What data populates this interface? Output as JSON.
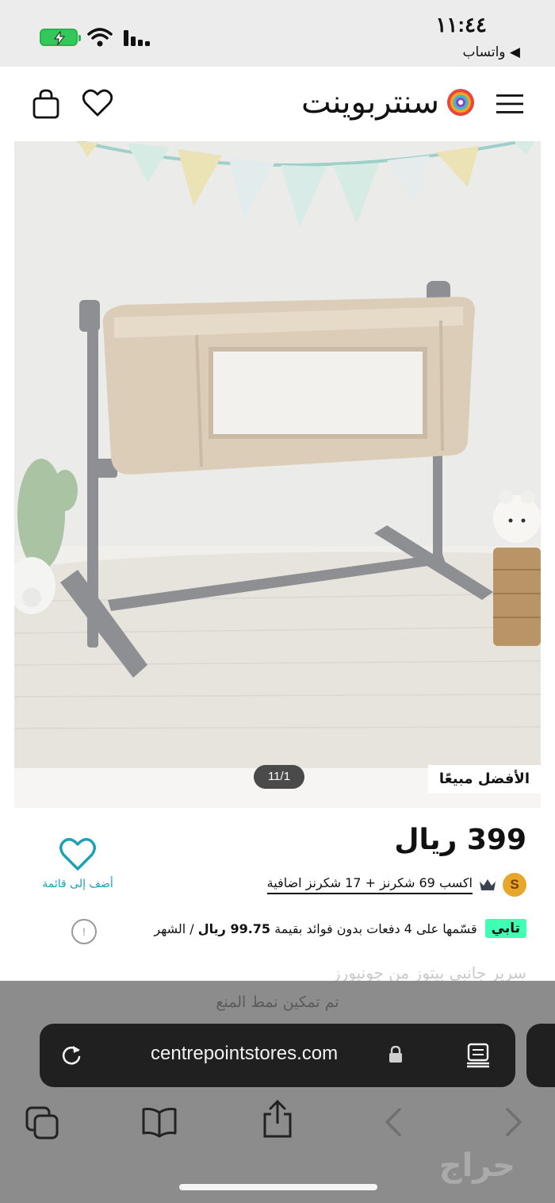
{
  "status_bar": {
    "time": "١١:٤٤",
    "back_link": "◀ واتساب"
  },
  "header": {
    "logo_text": "سنتربوينت",
    "icons": [
      "menu-icon",
      "logo-mark-icon",
      "heart-icon",
      "shopping-bag-icon"
    ]
  },
  "product": {
    "image_counter": "11/1",
    "bestseller_badge": "الأفضل مبيعًا",
    "price": "399 ريال",
    "wishlist_label": "أضف إلى قائمة",
    "points_badge": "S",
    "points_text": "اكسب 69 شكرنز +  17 شكرنز اضافية",
    "tabby_logo": "تابي",
    "tabby_text_prefix": "قسّمها على 4 دفعات بدون فوائد بقيمة",
    "tabby_amount": "99.75 ريال",
    "tabby_suffix": "/ الشهر",
    "info_glyph": "!",
    "truncated_text": "سرير جانبي بيتوز من جونيورز"
  },
  "browser": {
    "blocker_notice": "تم تمكين نمط المنع",
    "url": "centrepointstores.com",
    "toolbar_icons": [
      "tabs-icon",
      "bookmarks-icon",
      "share-icon",
      "back-icon",
      "forward-icon"
    ]
  },
  "watermark": "حراج",
  "colors": {
    "accent_teal": "#1aa1b5",
    "tabby_green": "#3effb2",
    "points_gold": "#e6a72a"
  }
}
